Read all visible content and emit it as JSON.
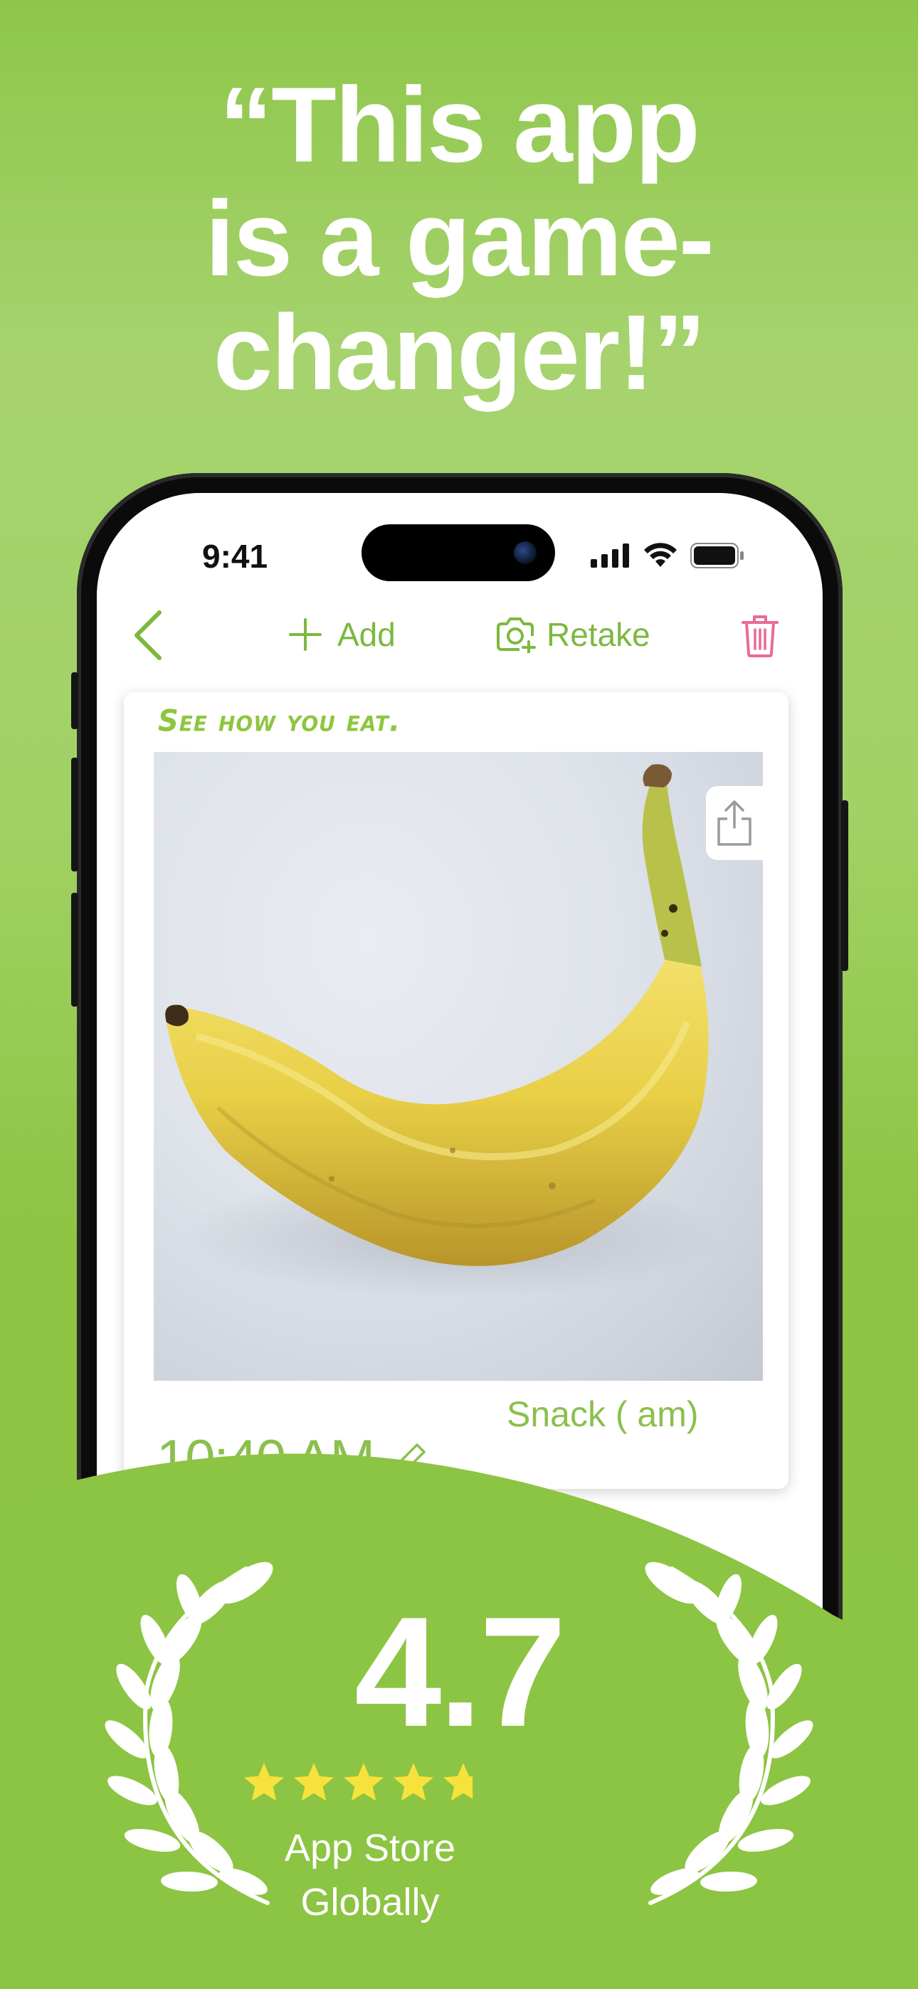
{
  "headline": {
    "line1": "“This app",
    "line2": "is a game-",
    "line3": "changer!”"
  },
  "status_bar": {
    "time": "9:41"
  },
  "nav": {
    "add_label": "Add",
    "retake_label": "Retake"
  },
  "card": {
    "brand": "See how you eat.",
    "time": "10:40 AM",
    "meal": "Snack ( am)"
  },
  "rating": {
    "value": "4.7",
    "stars": 4.7,
    "line1": "App Store",
    "line2": "Globally"
  },
  "colors": {
    "background": "#8cc443",
    "accent_green": "#7cb83f",
    "trash_pink": "#e96b93",
    "star_yellow": "#f7e23b"
  }
}
